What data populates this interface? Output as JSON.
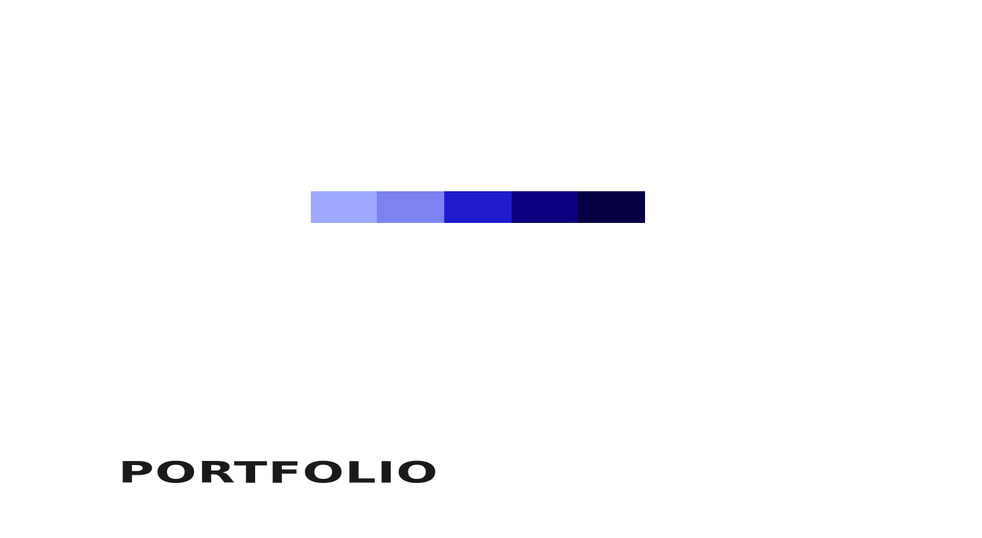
{
  "palette": {
    "swatches": [
      {
        "color": "#9daaff"
      },
      {
        "color": "#7b82f2"
      },
      {
        "color": "#1f1cce"
      },
      {
        "color": "#0a0080"
      },
      {
        "color": "#050045"
      }
    ]
  },
  "footer": {
    "title": "PORTFOLIO"
  }
}
